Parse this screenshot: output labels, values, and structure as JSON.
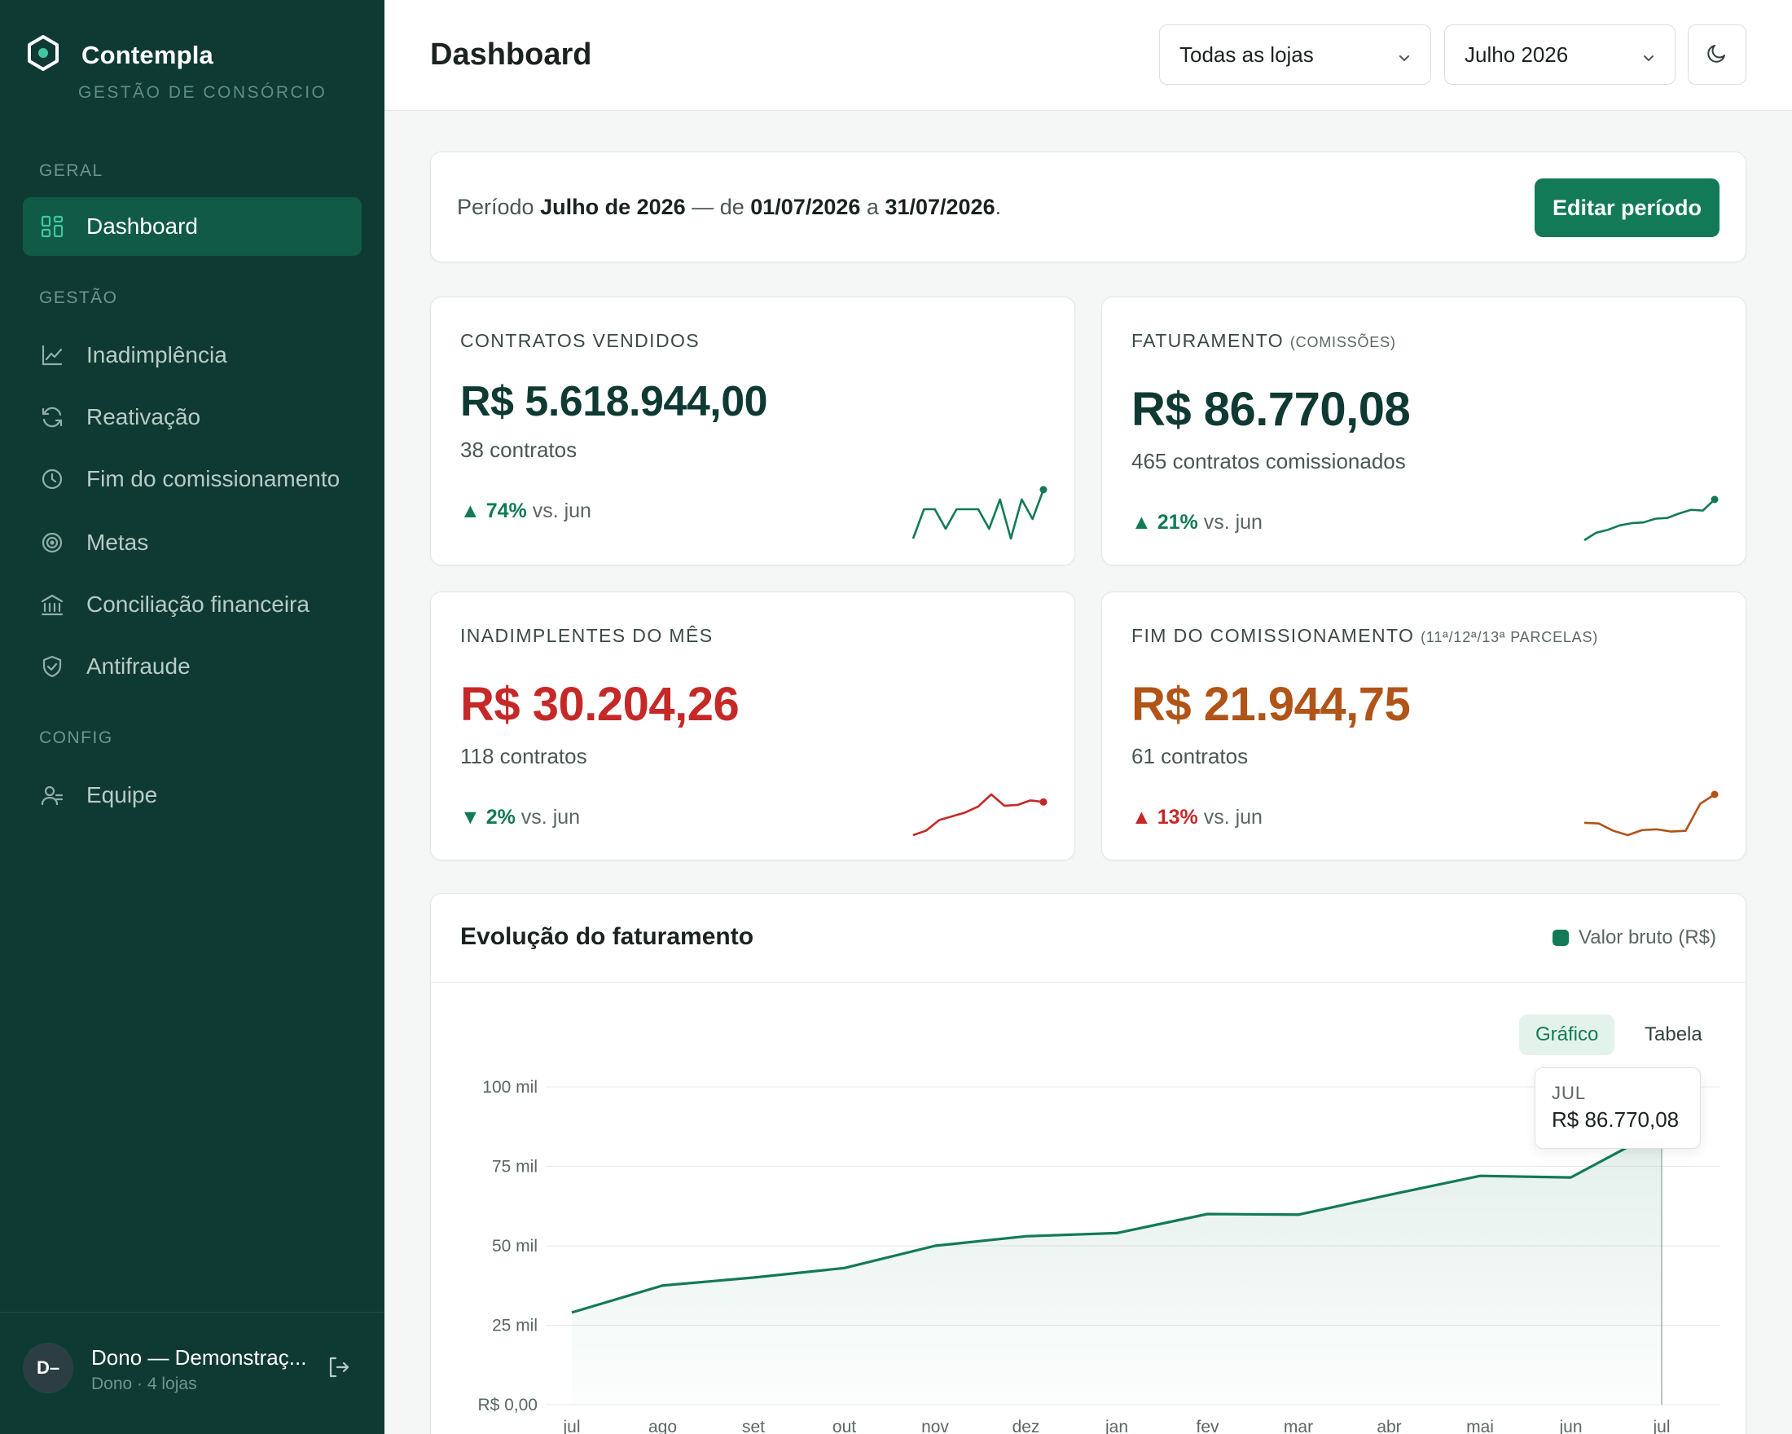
{
  "app": {
    "name": "Contempla",
    "subtitle": "GESTÃO DE CONSÓRCIO"
  },
  "sidebar": {
    "sections": [
      {
        "label": "GERAL"
      },
      {
        "label": "GESTÃO"
      },
      {
        "label": "CONFIG"
      }
    ],
    "items": [
      {
        "label": "Dashboard",
        "icon": "grid-icon",
        "active": true
      },
      {
        "label": "Inadimplência",
        "icon": "line-chart-icon"
      },
      {
        "label": "Reativação",
        "icon": "refresh-icon"
      },
      {
        "label": "Fim do comissionamento",
        "icon": "clock-icon"
      },
      {
        "label": "Metas",
        "icon": "target-icon"
      },
      {
        "label": "Conciliação financeira",
        "icon": "bank-icon"
      },
      {
        "label": "Antifraude",
        "icon": "shield-check-icon"
      },
      {
        "label": "Equipe",
        "icon": "users-icon"
      }
    ],
    "user": {
      "initials": "D–",
      "name": "Dono — Demonstraç...",
      "role": "Dono · 4 lojas"
    }
  },
  "header": {
    "title": "Dashboard",
    "store_select": "Todas as lojas",
    "month_select": "Julho 2026"
  },
  "period": {
    "prefix": "Período",
    "name": "Julho de 2026",
    "mid": "— de",
    "start": "01/07/2026",
    "joiner": "a",
    "end": "31/07/2026",
    "suffix": ".",
    "edit_label": "Editar período"
  },
  "kpis": [
    {
      "label": "CONTRATOS VENDIDOS",
      "label_note": "",
      "value": "R$ 5.618.944,00",
      "sub": "38 contratos",
      "delta_arrow": "▲",
      "delta": "74%",
      "delta_suffix": "vs. jun",
      "color": "#0f3a33",
      "delta_color": "#127a57",
      "spark_color": "#127a57",
      "spark": [
        3,
        6,
        6,
        4,
        6,
        6,
        6,
        4,
        7,
        3,
        7,
        5,
        8
      ]
    },
    {
      "label": "FATURAMENTO",
      "label_note": "(COMISSÕES)",
      "value": "R$ 86.770,08",
      "sub": "465 contratos comissionados",
      "delta_arrow": "▲",
      "delta": "21%",
      "delta_suffix": "vs. jun",
      "color": "#0f3a33",
      "delta_color": "#127a57",
      "spark_color": "#127a57",
      "spark": [
        1,
        2,
        2.4,
        3,
        3.3,
        3.4,
        3.9,
        4,
        4.6,
        5.1,
        5,
        6.5
      ]
    },
    {
      "label": "INADIMPLENTES DO MÊS",
      "label_note": "",
      "value": "R$ 30.204,26",
      "sub": "118 contratos",
      "delta_arrow": "▼",
      "delta": "2%",
      "delta_suffix": "vs. jun",
      "color": "#c62828",
      "delta_color": "#127a57",
      "spark_color": "#c62828",
      "spark": [
        1,
        1.6,
        3,
        3.5,
        4,
        4.8,
        6.4,
        4.9,
        5,
        5.6,
        5.4
      ]
    },
    {
      "label": "FIM DO COMISSIONAMENTO",
      "label_note": "(11ª/12ª/13ª PARCELAS)",
      "value": "R$ 21.944,75",
      "sub": "61 contratos",
      "delta_arrow": "▲",
      "delta": "13%",
      "delta_suffix": "vs. jun",
      "color": "#b05417",
      "delta_color": "#c62828",
      "spark_color": "#b05417",
      "spark": [
        3.6,
        3.5,
        2.5,
        1.9,
        2.6,
        2.7,
        2.4,
        2.5,
        6.2,
        7.5
      ]
    }
  ],
  "chart": {
    "title": "Evolução do faturamento",
    "legend": "Valor bruto (R$)",
    "toggle_chart": "Gráfico",
    "toggle_table": "Tabela",
    "tooltip_month": "JUL",
    "tooltip_value": "R$ 86.770,08"
  },
  "chart_data": {
    "type": "area",
    "title": "Evolução do faturamento",
    "series": [
      {
        "name": "Valor bruto (R$)",
        "values": [
          29000,
          37500,
          40000,
          43000,
          50000,
          53000,
          54000,
          60000,
          59800,
          66000,
          72000,
          71500,
          86770.08
        ]
      }
    ],
    "categories": [
      "jul",
      "ago",
      "set",
      "out",
      "nov",
      "dez",
      "jan",
      "fev",
      "mar",
      "abr",
      "mai",
      "jun",
      "jul"
    ],
    "y_ticks": [
      "R$ 0,00",
      "25 mil",
      "50 mil",
      "75 mil",
      "100 mil"
    ],
    "ylim": [
      0,
      100000
    ],
    "grid": true,
    "color": "#127a57"
  }
}
